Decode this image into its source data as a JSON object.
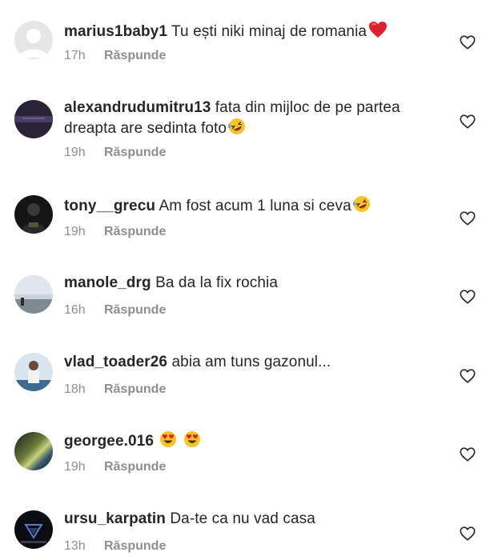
{
  "comments": [
    {
      "username": "marius1baby1",
      "text": "Tu ești niki minaj de romania",
      "emoji": "red-heart",
      "time": "17h",
      "reply": "Răspunde"
    },
    {
      "username": "alexandrudumitru13",
      "text": "fata din mijloc de pe partea",
      "text2": "dreapta are sedinta foto",
      "emoji": "rolling-laughing",
      "time": "19h",
      "reply": "Răspunde"
    },
    {
      "username": "tony__grecu",
      "text": "Am fost acum 1 luna si ceva",
      "emoji": "rolling-laughing",
      "time": "19h",
      "reply": "Răspunde"
    },
    {
      "username": "manole_drg",
      "text": "Ba da la fix rochia",
      "time": "16h",
      "reply": "Răspunde"
    },
    {
      "username": "vlad_toader26",
      "text": "abia am tuns gazonul...",
      "time": "18h",
      "reply": "Răspunde"
    },
    {
      "username": "georgee.016",
      "text": "",
      "emoji": "heart-eyes",
      "time": "19h",
      "reply": "Răspunde"
    },
    {
      "username": "ursu_karpatin",
      "text": "Da-te ca nu vad casa",
      "time": "13h",
      "reply": "Răspunde"
    }
  ],
  "colors": {
    "text": "#262626",
    "secondary": "#8e8e8e",
    "heart_outline": "#262626"
  },
  "icons": {
    "like": "heart-outline-icon"
  }
}
